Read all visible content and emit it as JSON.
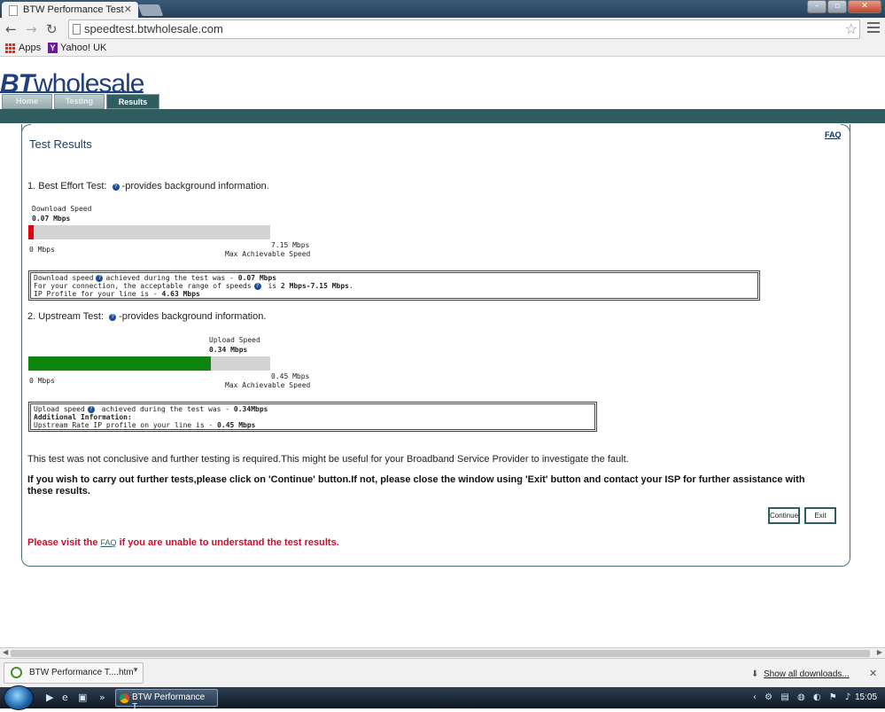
{
  "browser": {
    "tab_title": "BTW Performance Test",
    "url": "speedtest.btwholesale.com",
    "bookmarks": [
      "Apps",
      "Yahoo! UK"
    ]
  },
  "site": {
    "logo_bt": "BT",
    "logo_rest": "wholesale",
    "nav_tabs": [
      {
        "label": "Home",
        "active": false
      },
      {
        "label": "Testing",
        "active": false
      },
      {
        "label": "Results",
        "active": true
      }
    ],
    "faq": "FAQ"
  },
  "results": {
    "heading": "Test Results",
    "best_effort": {
      "heading_prefix": "1. Best Effort Test:",
      "heading_suffix": "-provides background information.",
      "bar_title": "Download  Speed",
      "value": "0.07 Mbps",
      "min_label": "0 Mbps",
      "max_label": "7.15 Mbps",
      "max_caption": "Max Achievable Speed",
      "fill_fraction": 0.0098,
      "fill_color": "#e2000f",
      "info": {
        "line1_pre": "Download speed",
        "line1_mid": "achieved during the test was - ",
        "line1_val": "0.07 Mbps",
        "line2_pre": "For your connection, the acceptable range of speeds",
        "line2_mid": " is ",
        "line2_val": "2 Mbps-7.15 Mbps",
        "line3_pre": "IP Profile for your line is - ",
        "line3_val": "4.63 Mbps"
      }
    },
    "upstream": {
      "heading_prefix": "2. Upstream Test:",
      "heading_suffix": "-provides background information.",
      "bar_title": "Upload Speed",
      "value": "0.34 Mbps",
      "min_label": "0 Mbps",
      "max_label": "0.45 Mbps",
      "max_caption": "Max Achievable Speed",
      "fill_fraction": 0.7556,
      "fill_color": "#0f850f",
      "info": {
        "line1_pre": "Upload speed",
        "line1_mid": " achieved during the test was - ",
        "line1_val": "0.34Mbps",
        "line2": "Additional Information:",
        "line3_pre": "Upstream Rate IP profile on your line is - ",
        "line3_val": "0.45 Mbps"
      }
    },
    "conclusion": "This test was not conclusive and further testing is required.This might be useful for your Broadband Service Provider to investigate the fault.",
    "instruction": "If you wish to carry out further tests,please click on 'Continue' button.If not, please close the window using 'Exit' button and contact your ISP for further assistance with these results.",
    "continue_label": "Continue",
    "exit_label": "Exit",
    "faq_prefix": "Please visit the ",
    "faq_link": "FAQ",
    "faq_suffix": " if you are unable to understand the test results."
  },
  "download_bar": {
    "item": "BTW Performance T....htm",
    "show_all": "Show all downloads..."
  },
  "taskbar": {
    "task_label": "BTW Performance T...",
    "time": "15:05"
  }
}
